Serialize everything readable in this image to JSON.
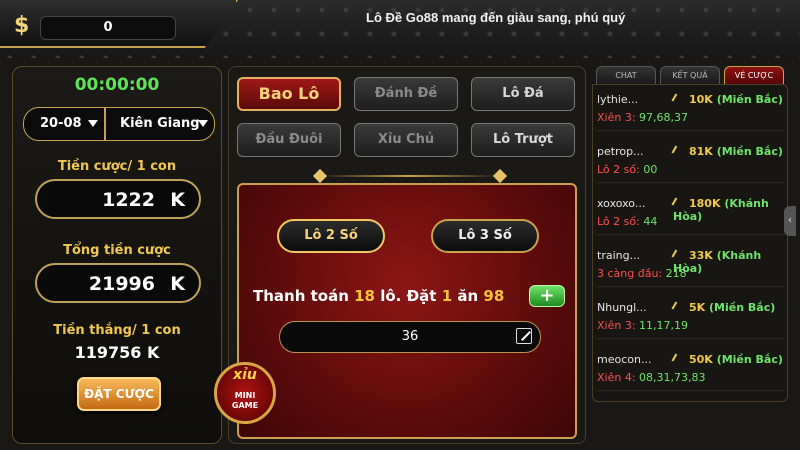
{
  "header": {
    "currency_symbol": "$",
    "balance": "0",
    "slogan": "Lô Đề Go88 mang đến giàu sang, phú quý"
  },
  "left": {
    "timer": "00:00:00",
    "date": "20-08",
    "province": "Kiên Giang",
    "bet_per_label": "Tiền cược/ 1 con",
    "bet_per_value": "1222",
    "bet_per_unit": "K",
    "total_label": "Tổng tiền cược",
    "total_value": "21996",
    "total_unit": "K",
    "win_label": "Tiền thắng/ 1 con",
    "win_value": "119756 K",
    "bet_button": "ĐẶT CƯỢC"
  },
  "modes": [
    {
      "label": "Bao Lô",
      "state": "active"
    },
    {
      "label": "Đánh Đề",
      "state": "disabled"
    },
    {
      "label": "Lô Đá",
      "state": "enabled"
    },
    {
      "label": "Đầu Đuôi",
      "state": "disabled"
    },
    {
      "label": "Xỉu Chủ",
      "state": "disabled"
    },
    {
      "label": "Lô Trượt",
      "state": "enabled"
    }
  ],
  "board": {
    "sub_modes": [
      "Lô 2 Số",
      "Lô 3 Số"
    ],
    "active_sub_mode": "Lô 2 Số",
    "pay_prefix": "Thanh toán",
    "pay_count": "18",
    "pay_mid": "lô. Đặt",
    "pay_bet": "1",
    "pay_eat": "ăn",
    "pay_win": "98",
    "plus": "+",
    "number_input": "36"
  },
  "mini_game": {
    "top": "xỉu",
    "line1": "MINI",
    "line2": "GAME"
  },
  "right": {
    "tabs": [
      "CHAT",
      "KẾT QUẢ",
      "VÉ CƯỢC"
    ],
    "active_tab": "VÉ CƯỢC",
    "feed": [
      {
        "user": "lythie...",
        "amount": "10K",
        "region": "(Miền Bắc)",
        "bet_type": "Xiên 3:",
        "numbers": "97,68,37"
      },
      {
        "user": "petrop...",
        "amount": "81K",
        "region": "(Miền Bắc)",
        "bet_type": "Lô 2 số:",
        "numbers": "00"
      },
      {
        "user": "xoxoxo...",
        "amount": "180K",
        "region": "(Khánh Hòa)",
        "bet_type": "Lô 2 số:",
        "numbers": "44"
      },
      {
        "user": "traing...",
        "amount": "33K",
        "region": "(Khánh Hòa)",
        "bet_type": "3 càng đầu:",
        "numbers": "218"
      },
      {
        "user": "Nhungl...",
        "amount": "5K",
        "region": "(Miền Bắc)",
        "bet_type": "Xiên 3:",
        "numbers": "11,17,19"
      },
      {
        "user": "meocon...",
        "amount": "50K",
        "region": "(Miền Bắc)",
        "bet_type": "Xiên 4:",
        "numbers": "08,31,73,83"
      }
    ]
  },
  "colors": {
    "gold": "#c9a24d",
    "timer_green": "#5fe35a",
    "label_yellow": "#f1c84e",
    "active_red": "#a01818",
    "bet_red": "#ff4d4d",
    "number_green": "#6fe36a"
  }
}
